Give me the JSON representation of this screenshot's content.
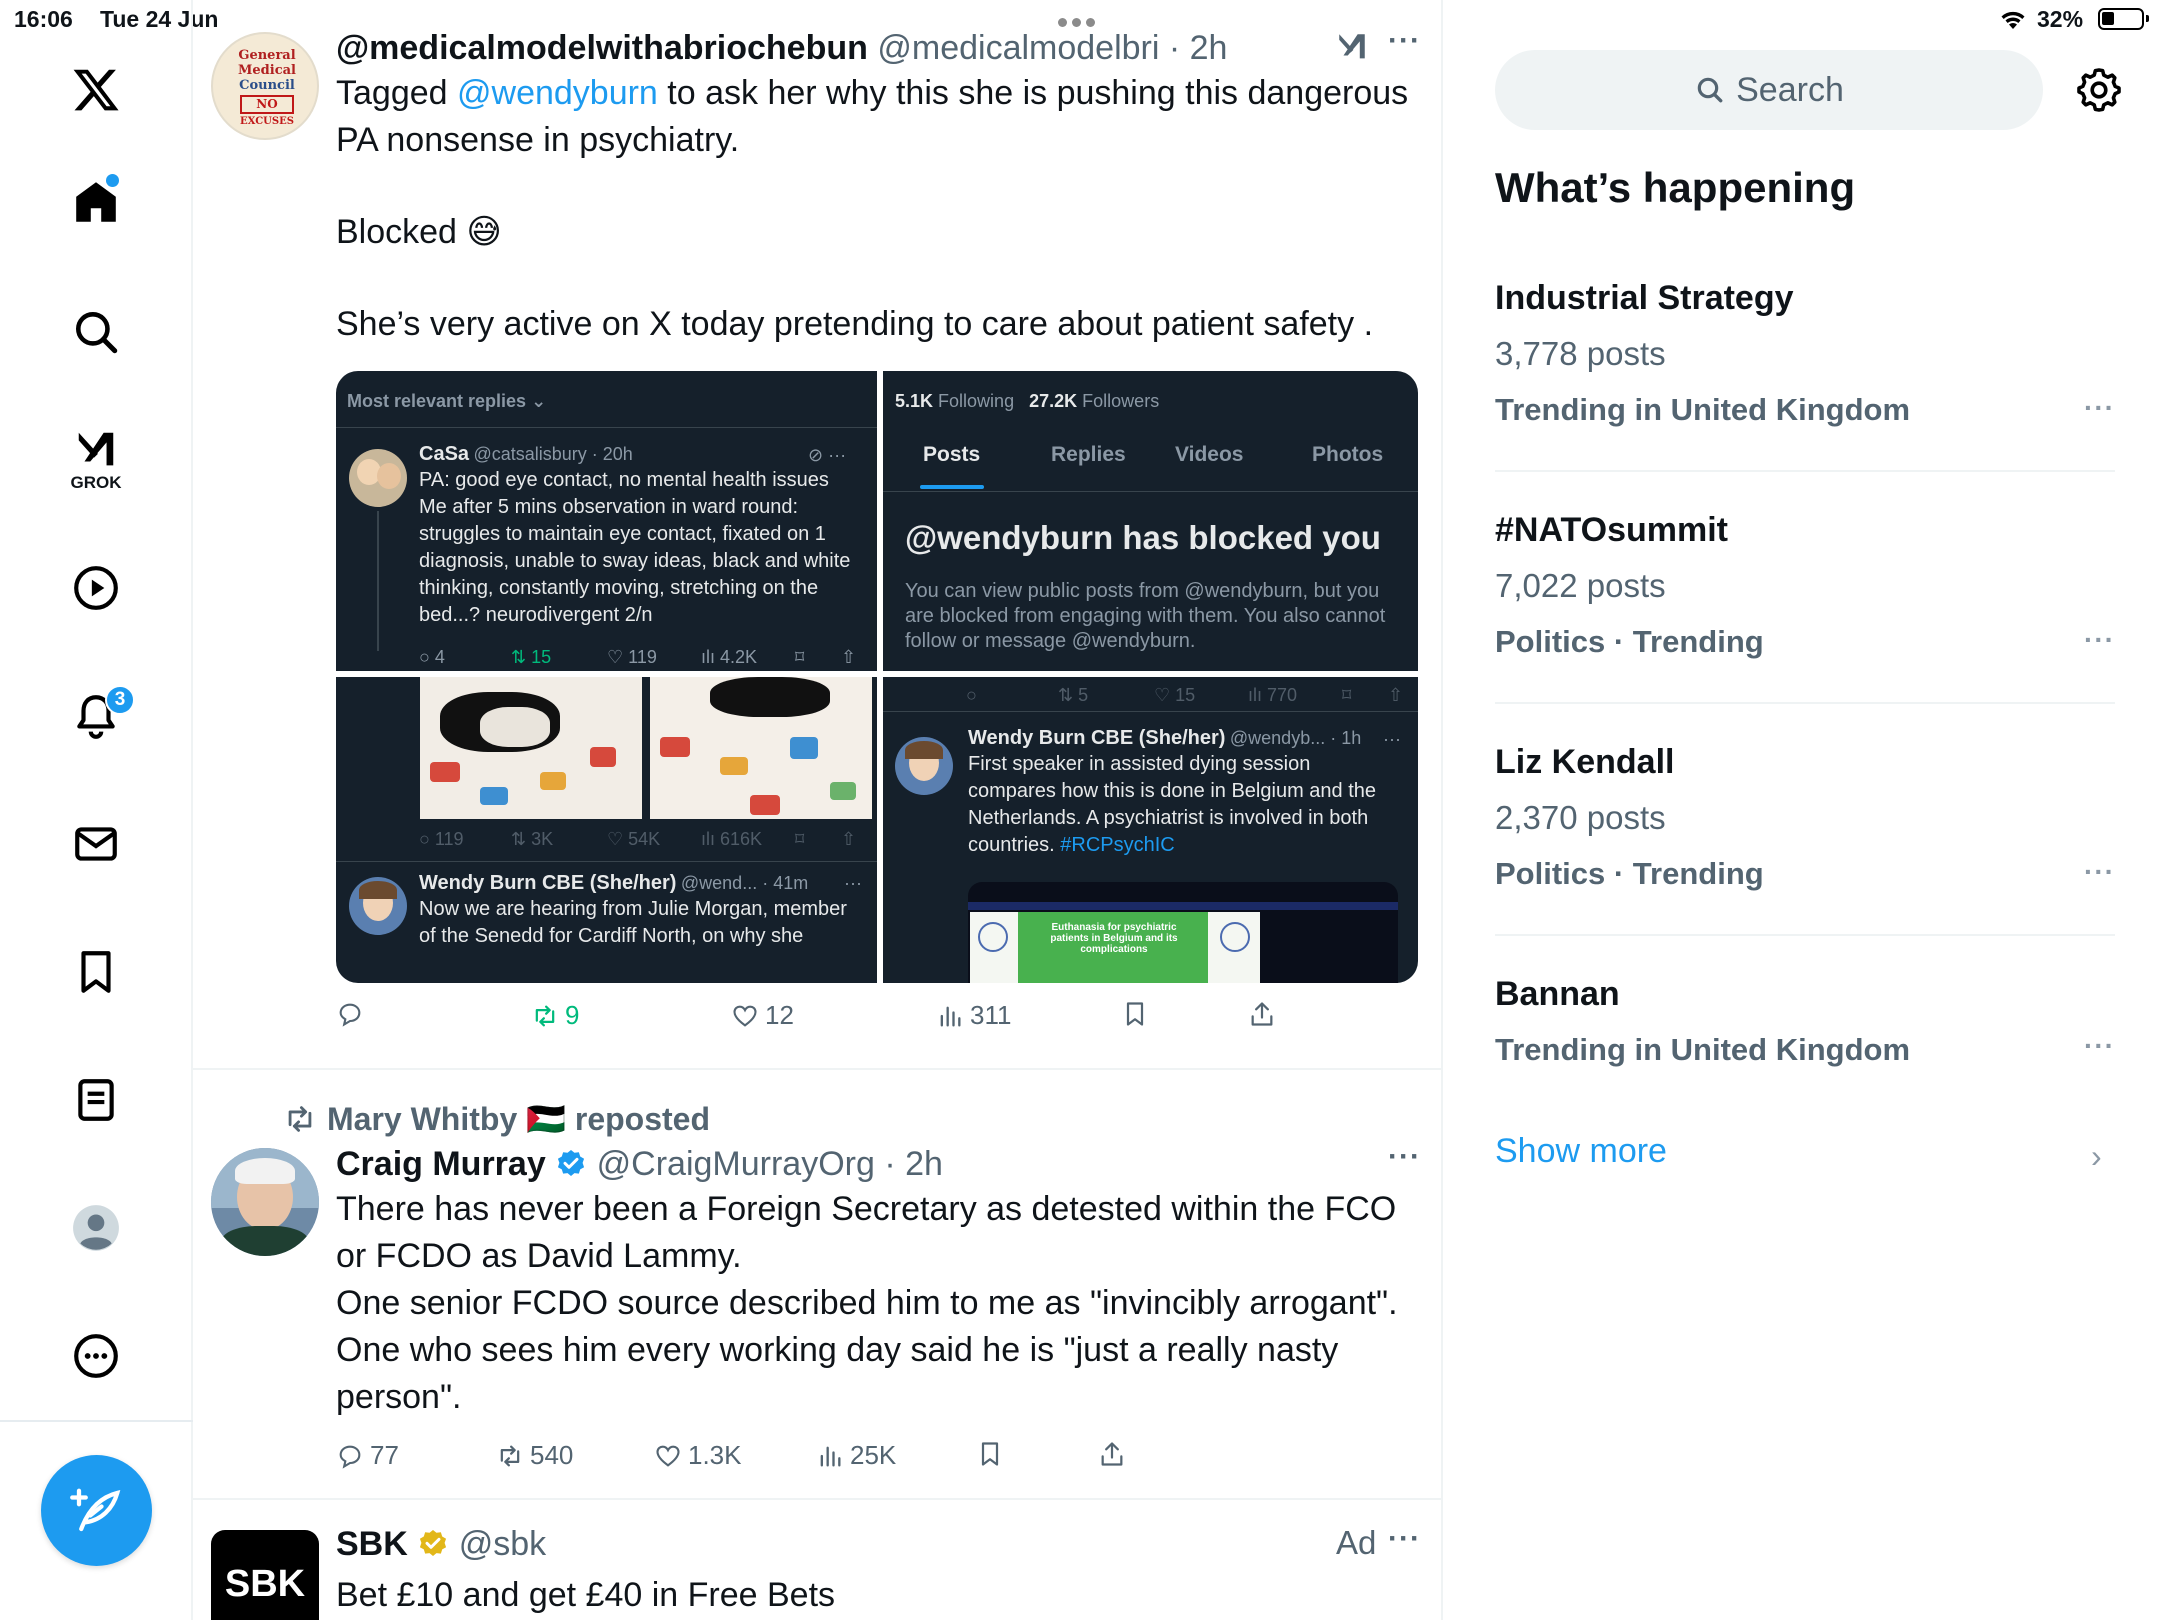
{
  "status_bar": {
    "time": "16:06",
    "date": "Tue 24 Jun",
    "battery": "32%"
  },
  "nav": {
    "grok_label": "GROK",
    "notifications_badge": "3"
  },
  "tweets": [
    {
      "name": "@medicalmodelwithabriochebun",
      "handle": "@medicalmodelbri",
      "time": "2h",
      "text_parts": {
        "t1": "Tagged ",
        "mention": "@wendyburn",
        "t2": " to ask her why this she is pushing this dangerous PA nonsense in psychiatry.",
        "t3": "Blocked 😅",
        "t4": "She’s very active on X today pretending to care about patient safety ."
      },
      "avatar_text": {
        "l1": "General",
        "l2": "Medical",
        "l3": "Council",
        "l4": "NO",
        "l5": "EXCUSES"
      },
      "media": {
        "c1": {
          "header": "Most relevant replies",
          "name": "CaSa",
          "handle": "@catsalisbury · 20h",
          "text": "PA: good eye contact, no mental health issues Me after 5 mins observation in ward round: struggles to maintain eye contact, fixated on 1 diagnosis, unable to sway ideas, black and white thinking, constantly moving, stretching on the bed...? neurodivergent 2/n",
          "stats": [
            "4",
            "15",
            "119",
            "4.2K"
          ]
        },
        "c2": {
          "following_n": "5.1K",
          "following_l": "Following",
          "followers_n": "27.2K",
          "followers_l": "Followers",
          "tabs": [
            "Posts",
            "Replies",
            "Videos",
            "Photos"
          ],
          "blocked_title": "@wendyburn has blocked you",
          "blocked_text": "You can view public posts from @wendyburn, but you are blocked from engaging with them. You also cannot follow or message @wendyburn."
        },
        "c3": {
          "stats": [
            "119",
            "3K",
            "54K",
            "616K"
          ],
          "name": "Wendy Burn CBE (She/her)",
          "handle": "@wend... · 41m",
          "text": "Now we are hearing from Julie Morgan, member of the Senedd for Cardiff  North, on why she"
        },
        "c4": {
          "stats": [
            "",
            "5",
            "15",
            "770"
          ],
          "name": "Wendy Burn CBE (She/her)",
          "handle": "@wendyb... · 1h",
          "text": "First speaker in assisted dying session compares how this is done in Belgium and the Netherlands. A psychiatrist is involved in both countries. ",
          "hashtag": "#RCPsychIC",
          "slide_text": "Euthanasia for psychiatric patients in Belgium and its complications"
        }
      },
      "actions": {
        "replies": "",
        "reposts": "9",
        "likes": "12",
        "views": "311"
      }
    },
    {
      "reposted_by": "Mary Whitby 🇵🇸 reposted",
      "name": "Craig Murray",
      "handle": "@CraigMurrayOrg",
      "time": "2h",
      "text": "There has never been a Foreign Secretary as detested within the FCO or FCDO as David Lammy.\nOne senior FCDO source described him to me as \"invincibly arrogant\".\nOne who sees him every working day said he is \"just a really nasty person\".",
      "actions": {
        "replies": "77",
        "reposts": "540",
        "likes": "1.3K",
        "views": "25K"
      }
    },
    {
      "name": "SBK",
      "handle": "@sbk",
      "ad_label": "Ad",
      "avatar_text": "SBK",
      "text": "Bet £10 and get £40 in Free Bets"
    }
  ],
  "right": {
    "search_placeholder": "Search",
    "whats_happening": "What’s happening",
    "trends": [
      {
        "name": "Industrial Strategy",
        "count": "3,778 posts",
        "context": "Trending in United Kingdom"
      },
      {
        "name": "#NATOsummit",
        "count": "7,022 posts",
        "context": "Politics · Trending"
      },
      {
        "name": "Liz Kendall",
        "count": "2,370 posts",
        "context": "Politics · Trending"
      },
      {
        "name": "Bannan",
        "count": "",
        "context": "Trending in United Kingdom"
      }
    ],
    "show_more": "Show more"
  },
  "colors": {
    "accent": "#1d9bf0",
    "repost_green": "#00ba7c",
    "dim_bg": "#15202b",
    "verified_gold": "#e2b719"
  }
}
